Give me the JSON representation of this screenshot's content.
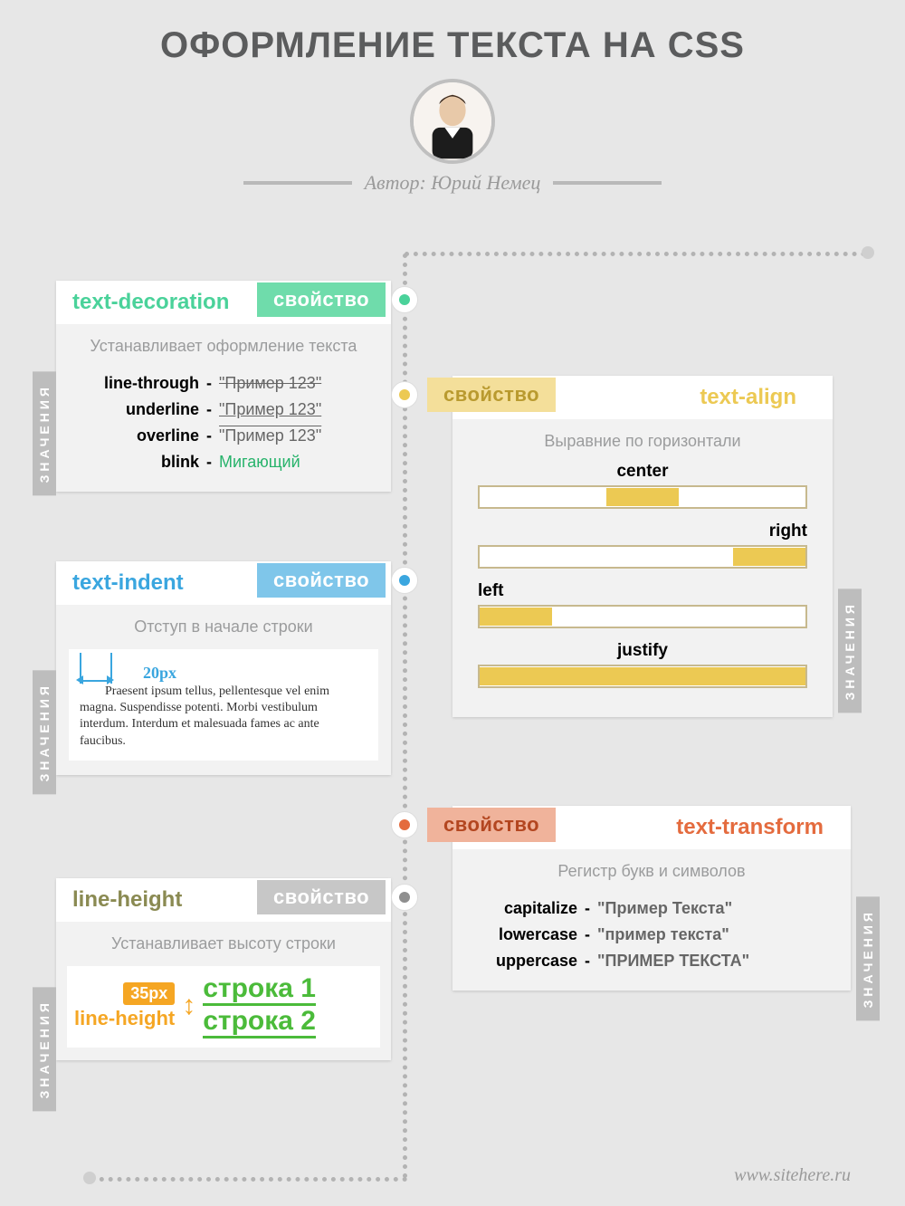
{
  "title": "ОФОРМЛЕНИЕ ТЕКСТА НА CSS",
  "author_prefix": "Автор:",
  "author_name": "Юрий Немец",
  "badge_text": "свойство",
  "side_label": "ЗНАЧЕНИЯ",
  "footer": "www.sitehere.ru",
  "colors": {
    "green": "#4ad29a",
    "blue": "#3aa6df",
    "gray": "#b0b0b0",
    "yellow": "#ecc953",
    "orange": "#e46b3e"
  },
  "cards": {
    "textDecoration": {
      "name": "text-decoration",
      "desc": "Устанавливает оформление текста",
      "items": [
        {
          "key": "line-through",
          "example": "\"Пример 123\"",
          "style": "strike"
        },
        {
          "key": "underline",
          "example": "\"Пример 123\"",
          "style": "under"
        },
        {
          "key": "overline",
          "example": "\"Пример 123\"",
          "style": "over"
        },
        {
          "key": "blink",
          "example": "Мигающий",
          "style": "blink"
        }
      ]
    },
    "textAlign": {
      "name": "text-align",
      "desc": "Выравние по горизонтали",
      "items": [
        "center",
        "right",
        "left",
        "justify"
      ]
    },
    "textIndent": {
      "name": "text-indent",
      "desc": "Отступ в начале строки",
      "measure": "20px",
      "sample": "Praesent ipsum tellus, pellentesque vel enim magna. Suspendisse potenti. Morbi vestibulum interdum. Interdum et malesuada fames ac ante faucibus."
    },
    "lineHeight": {
      "name": "line-height",
      "desc": "Устанавливает высоту строки",
      "value": "35px",
      "label": "line-height",
      "line1": "строка 1",
      "line2": "строка 2"
    },
    "textTransform": {
      "name": "text-transform",
      "desc": "Регистр букв и символов",
      "items": [
        {
          "key": "capitalize",
          "example": "\"Пример Текста\""
        },
        {
          "key": "lowercase",
          "example": "\"пример текста\""
        },
        {
          "key": "uppercase",
          "example": "\"ПРИМЕР ТЕКСТА\""
        }
      ]
    }
  }
}
